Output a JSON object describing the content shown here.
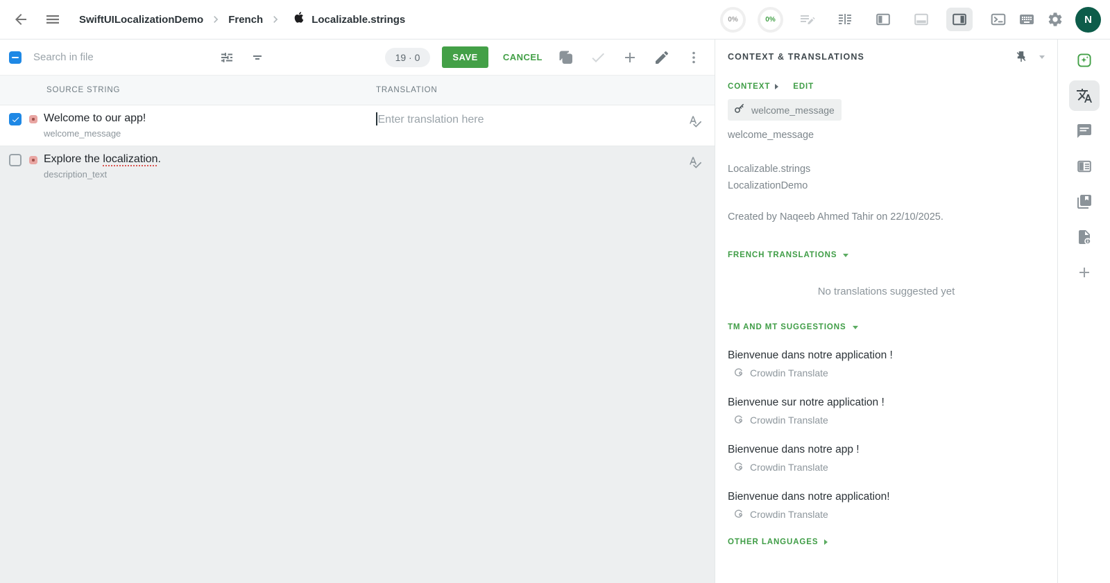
{
  "topbar": {
    "breadcrumb": [
      "SwiftUILocalizationDemo",
      "French",
      "Localizable.strings"
    ],
    "progress": [
      "0%",
      "0%"
    ],
    "avatar_initial": "N"
  },
  "toolbar": {
    "search_placeholder": "Search in file",
    "counter": "19 · 0",
    "save_label": "SAVE",
    "cancel_label": "CANCEL"
  },
  "table": {
    "headers": {
      "source": "SOURCE STRING",
      "translation": "TRANSLATION"
    },
    "rows": [
      {
        "source": "Welcome to our app!",
        "key": "welcome_message",
        "translation_placeholder": "Enter translation here",
        "checked": true
      },
      {
        "source_prefix": "Explore the ",
        "source_misspelled": "localization",
        "source_suffix": ".",
        "key": "description_text",
        "checked": false
      }
    ]
  },
  "sidebar": {
    "title": "CONTEXT & TRANSLATIONS",
    "context_label": "CONTEXT",
    "edit_label": "EDIT",
    "string_key_tag": "welcome_message",
    "context_value": "welcome_message",
    "file_name": "Localizable.strings",
    "project_name": "LocalizationDemo",
    "created_by": "Created by Naqeeb Ahmed Tahir on 22/10/2025.",
    "translations_section": "FRENCH TRANSLATIONS",
    "no_translations": "No translations suggested yet",
    "tm_section": "TM AND MT SUGGESTIONS",
    "suggestions": [
      {
        "text": "Bienvenue dans notre application !",
        "source": "Crowdin Translate"
      },
      {
        "text": "Bienvenue sur notre application !",
        "source": "Crowdin Translate"
      },
      {
        "text": "Bienvenue dans notre app !",
        "source": "Crowdin Translate"
      },
      {
        "text": "Bienvenue dans notre application!",
        "source": "Crowdin Translate"
      }
    ],
    "other_languages": "OTHER LANGUAGES"
  },
  "icons": [
    "back-icon",
    "menu-icon",
    "apple-icon",
    "progress-ring",
    "playlist-edit-icon",
    "split-view-icon",
    "left-panel-icon",
    "bottom-panel-icon",
    "right-panel-icon",
    "terminal-icon",
    "keyboard-icon",
    "gear-icon",
    "tune-icon",
    "filter-icon",
    "copy-source-icon",
    "approve-check-icon",
    "plus-icon",
    "pencil-icon",
    "more-vert-icon",
    "spellcheck-icon",
    "pin-off-icon",
    "key-icon",
    "crowdin-logo-icon",
    "ai-sparkle-icon",
    "translate-icon",
    "comment-icon",
    "reader-icon",
    "glossary-icon",
    "file-info-icon",
    "add-panel-icon"
  ],
  "colors": {
    "accent_green": "#43a047",
    "link_green": "#3f9d46",
    "checkbox_blue": "#1e88e5",
    "avatar_bg": "#0d5c4a",
    "status_pink": "#e9a6a3",
    "status_dot": "#a0524d"
  }
}
